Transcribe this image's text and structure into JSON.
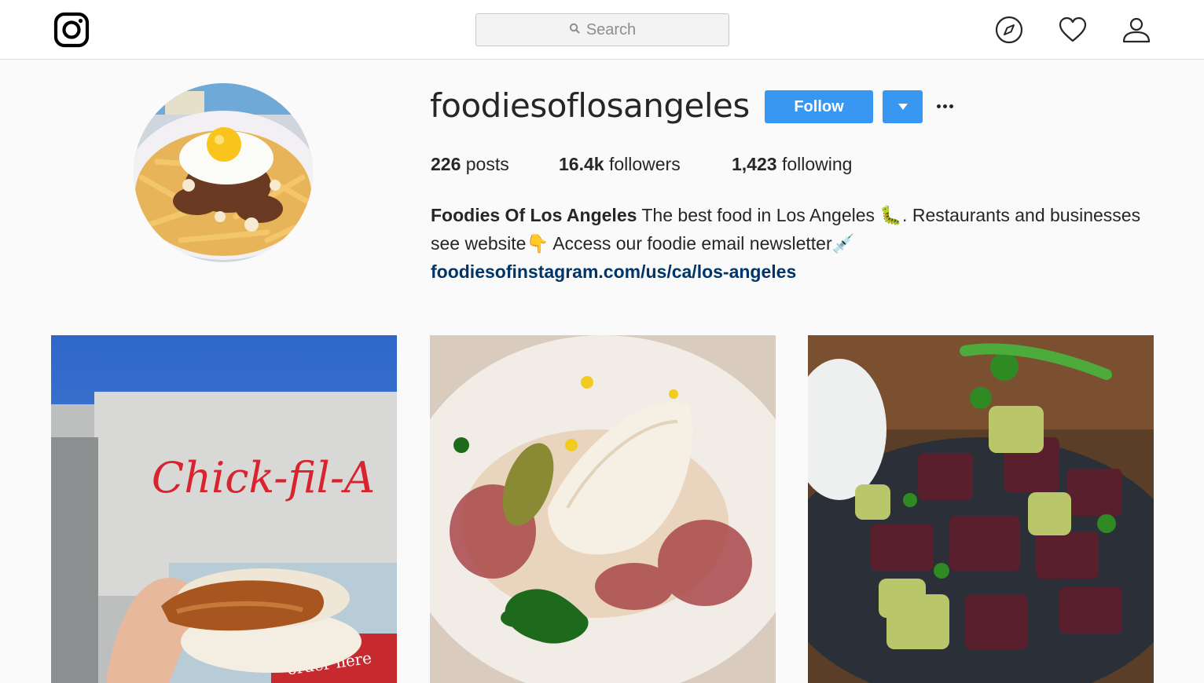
{
  "search": {
    "placeholder": "Search"
  },
  "profile": {
    "username": "foodiesoflosangeles",
    "follow_label": "Follow",
    "stats": [
      {
        "value": "226",
        "label": "posts"
      },
      {
        "value": "16.4k",
        "label": "followers"
      },
      {
        "value": "1,423",
        "label": "following"
      }
    ],
    "bio": {
      "name": "Foodies Of Los Angeles",
      "text_line1": " The best food in Los Angeles 🐛. Restaurants and businesses",
      "text_line2": "see website👇 Access our foodie email newsletter💉",
      "link": "foodiesofinstagram.com/us/ca/los-angeles"
    }
  },
  "posts": [
    {
      "sign_text": "Chick-fil-A",
      "awning_text": "order here"
    },
    {},
    {}
  ],
  "colors": {
    "accent": "#3897f0",
    "link": "#003569",
    "border": "#dbdbdb"
  },
  "icons": [
    "instagram-logo-icon",
    "search-icon",
    "explore-compass-icon",
    "heart-icon",
    "profile-user-icon",
    "more-options-icon",
    "dropdown-arrow-icon"
  ]
}
